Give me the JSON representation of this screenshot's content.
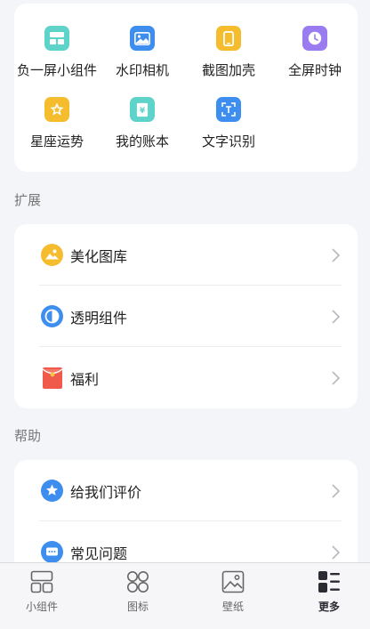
{
  "tools": [
    {
      "label": "负一屏小组件",
      "icon": "widget-grid-icon",
      "color": "#5dd3c9"
    },
    {
      "label": "水印相机",
      "icon": "photo-edit-icon",
      "color": "#3e8ef0"
    },
    {
      "label": "截图加壳",
      "icon": "phone-frame-icon",
      "color": "#f5bd2e"
    },
    {
      "label": "全屏时钟",
      "icon": "clock-icon",
      "color": "#9a7cf0"
    },
    {
      "label": "星座运势",
      "icon": "star-badge-icon",
      "color": "#f5bd2e"
    },
    {
      "label": "我的账本",
      "icon": "ledger-icon",
      "color": "#5dd3c9"
    },
    {
      "label": "文字识别",
      "icon": "text-scan-icon",
      "color": "#3e8ef0"
    }
  ],
  "sections": {
    "expand": {
      "title": "扩展",
      "items": [
        {
          "label": "美化图库",
          "icon": "gallery-icon",
          "color": "#f5bd2e"
        },
        {
          "label": "透明组件",
          "icon": "half-circle-icon",
          "color": "#3e8ef0"
        },
        {
          "label": "福利",
          "icon": "red-envelope-icon",
          "color": "#ef5a4a"
        }
      ]
    },
    "help": {
      "title": "帮助",
      "items": [
        {
          "label": "给我们评价",
          "icon": "star-rate-icon",
          "color": "#3e8ef0"
        },
        {
          "label": "常见问题",
          "icon": "chat-bubble-icon",
          "color": "#3e8ef0"
        }
      ]
    }
  },
  "tabbar": {
    "items": [
      {
        "label": "小组件",
        "icon": "widgets-tab-icon",
        "active": false
      },
      {
        "label": "图标",
        "icon": "icons-tab-icon",
        "active": false
      },
      {
        "label": "壁纸",
        "icon": "wallpaper-tab-icon",
        "active": false
      },
      {
        "label": "更多",
        "icon": "more-tab-icon",
        "active": true
      }
    ]
  }
}
